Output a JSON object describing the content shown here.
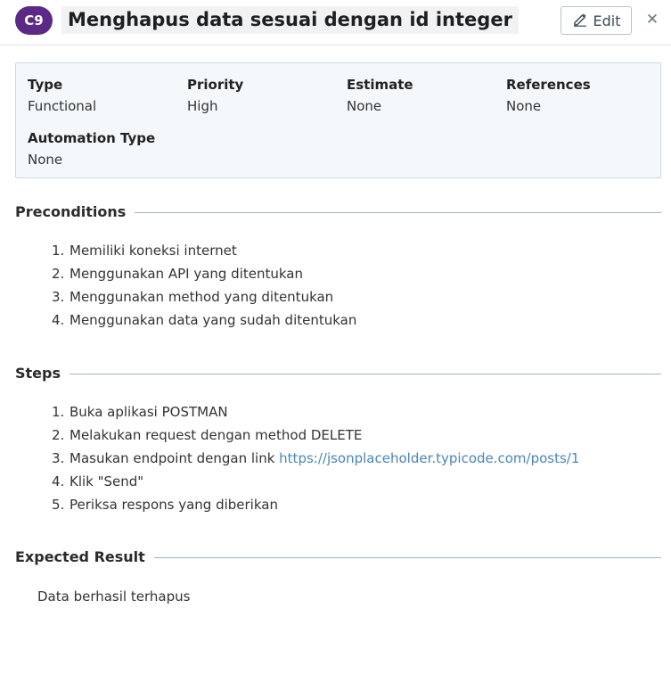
{
  "header": {
    "case_id": "C9",
    "title": "Menghapus data sesuai dengan id integer",
    "edit_label": "Edit",
    "close_symbol": "✕"
  },
  "info": {
    "type_label": "Type",
    "type_value": "Functional",
    "priority_label": "Priority",
    "priority_value": "High",
    "estimate_label": "Estimate",
    "estimate_value": "None",
    "references_label": "References",
    "references_value": "None",
    "automation_label": "Automation Type",
    "automation_value": "None"
  },
  "preconditions": {
    "title": "Preconditions",
    "items": [
      "Memiliki koneksi internet",
      "Menggunakan API yang ditentukan",
      "Menggunakan method yang ditentukan",
      "Menggunakan data yang sudah ditentukan"
    ]
  },
  "steps": {
    "title": "Steps",
    "items": [
      {
        "text": "Buka aplikasi POSTMAN"
      },
      {
        "text": "Melakukan request dengan method DELETE"
      },
      {
        "text": "Masukan endpoint dengan link ",
        "link": "https://jsonplaceholder.typicode.com/posts/1"
      },
      {
        "text": "Klik \"Send\""
      },
      {
        "text": "Periksa respons yang diberikan"
      }
    ]
  },
  "expected": {
    "title": "Expected Result",
    "text": "Data berhasil terhapus"
  },
  "colors": {
    "badge": "#5b2a86",
    "link": "#4a86b8",
    "info_bg": "#f4f8fb"
  },
  "icons": {
    "edit": "pencil-icon",
    "close": "close-icon"
  }
}
